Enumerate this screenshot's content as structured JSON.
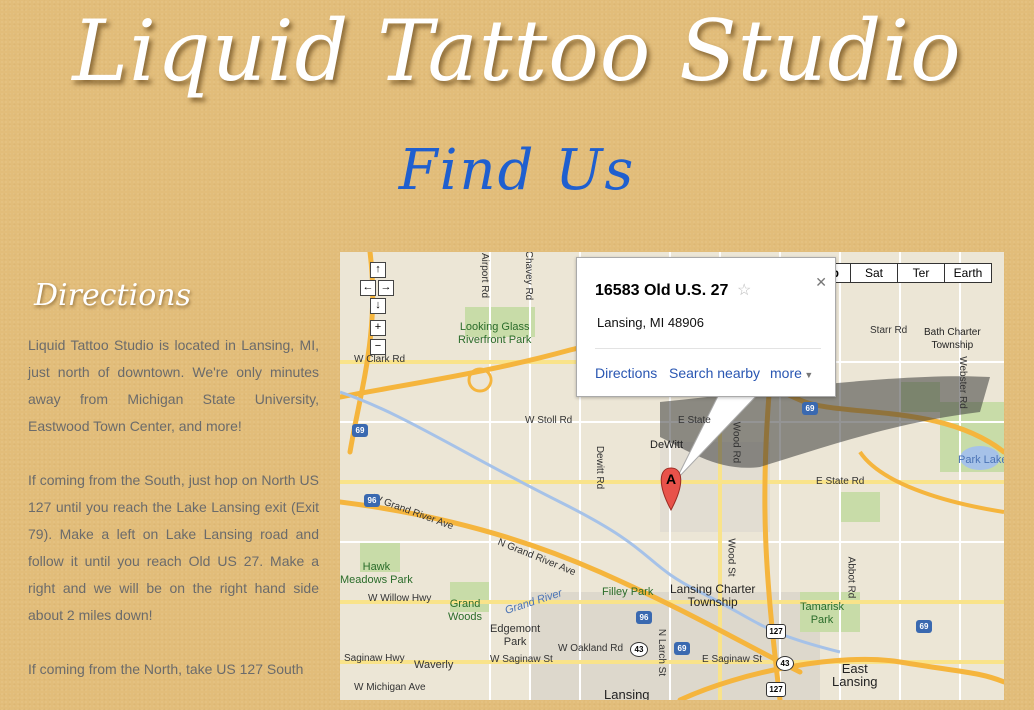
{
  "site": {
    "title": "Liquid Tattoo Studio",
    "page_heading": "Find Us"
  },
  "directions": {
    "heading": "Directions",
    "paragraphs": [
      "Liquid Tattoo Studio is located in Lansing, MI, just north of downtown. We're only minutes away from Michigan State University, Eastwood Town Center, and more!",
      "If coming from the South, just hop on North US 127 until you reach the Lake Lansing exit (Exit 79). Make a left on Lake Lansing road and follow it until you reach Old US 27. Make a right and we will be on the right hand side about 2 miles down!",
      "If coming from the North, take US 127 South"
    ]
  },
  "map": {
    "types": [
      "Map",
      "Sat",
      "Ter",
      "Earth"
    ],
    "selected_type": "Map",
    "nav": {
      "up": "↑",
      "left": "←",
      "right": "→",
      "down": "↓",
      "zoom_in": "+",
      "zoom_out": "−"
    },
    "info": {
      "address": "16583 Old U.S. 27",
      "star": "☆",
      "close": "✕",
      "city": "Lansing, MI 48906",
      "links": [
        "Directions",
        "Search nearby",
        "more"
      ]
    },
    "marker": "A",
    "roads": {
      "clark": "W Clark Rd",
      "stoll": "W Stoll Rd",
      "grand_river": "W Grand River Ave",
      "n_grand_river": "N Grand River Ave",
      "willow": "W Willow Hwy",
      "saginaw": "Saginaw Hwy",
      "w_saginaw": "W Saginaw St",
      "e_saginaw": "E Saginaw St",
      "oakland": "W Oakland Rd",
      "michigan": "W Michigan Ave",
      "state": "E State Rd",
      "state_w": "E State",
      "starr": "Starr Rd",
      "bath": "Bath Charter\nTownship",
      "dewitt_rd": "Dewitt Rd",
      "wood": "Wood St",
      "woodrd": "Wood Rd",
      "abbot": "Abbot Rd",
      "webster": "Webster Rd",
      "airport": "Airport Rd",
      "chavey": "Chavey Rd",
      "larch": "N Larch St",
      "waverly": "Waverly"
    },
    "places": {
      "looking_glass": "Looking Glass\nRiverfront Park",
      "hawk": "Hawk\nMeadows Park",
      "grand_woods": "Grand\nWoods",
      "edgemont": "Edgemont\nPark",
      "filley": "Filley Park",
      "lansing_charter": "Lansing Charter\nTownship",
      "tamarisk": "Tamarisk\nPark",
      "park_lake": "Park Lake",
      "dewitt": "DeWitt",
      "lansing": "Lansing",
      "east_lansing": "East\nLansing",
      "grand_river_water": "Grand River"
    },
    "shields": {
      "i69a": "69",
      "i69b": "69",
      "i96": "96",
      "i96b": "96",
      "us127": "127",
      "us127b": "127",
      "m43a": "43",
      "m43b": "43",
      "i69c": "69",
      "i69d": "69"
    }
  }
}
